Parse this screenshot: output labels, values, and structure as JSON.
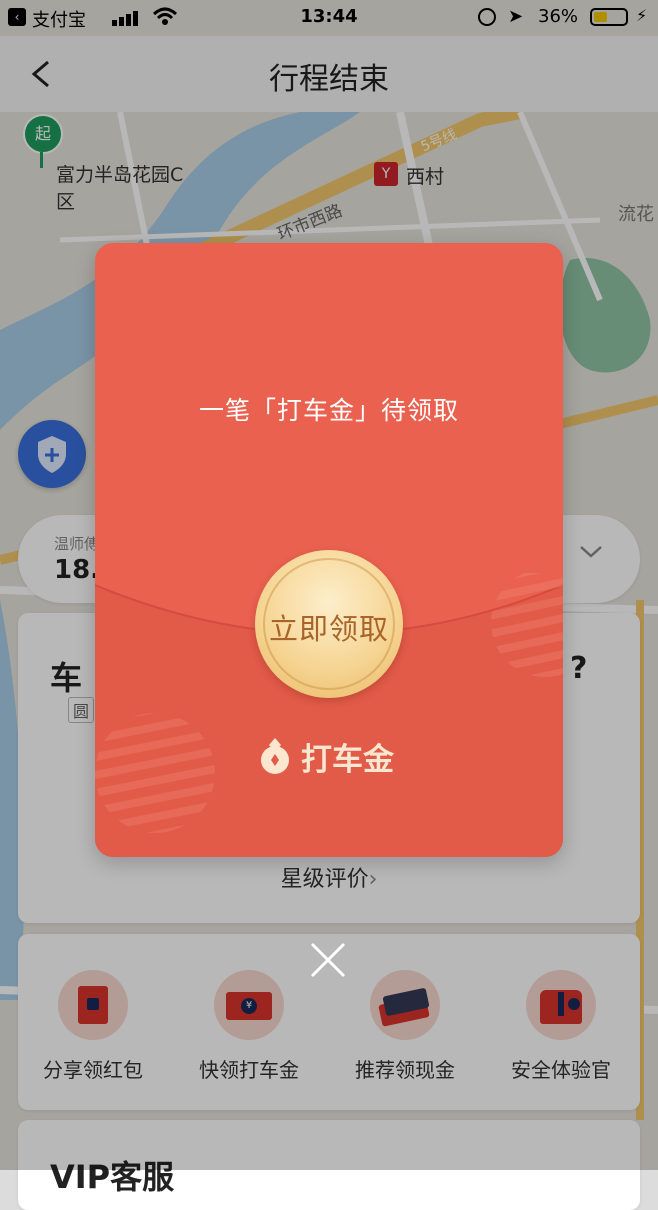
{
  "statusbar": {
    "back_app": "支付宝",
    "time": "13:44",
    "battery_pct": "36%"
  },
  "nav": {
    "title": "行程结束"
  },
  "map": {
    "start_badge": "起",
    "start_place_line1": "富力半岛花园C",
    "start_place_line2": "区",
    "metro_icon": "Y",
    "metro_station": "西村",
    "road1": "环市西路",
    "road2": "5号线",
    "corner_label": "流花"
  },
  "fare": {
    "label": "温师傅",
    "value": "18.7"
  },
  "driver": {
    "name_prefix": "车",
    "badge": "圆",
    "rating_link": "星级评价",
    "help": "?"
  },
  "services": [
    {
      "label": "分享领红包",
      "icon": "red-envelope-icon"
    },
    {
      "label": "快领打车金",
      "icon": "cash-voucher-icon"
    },
    {
      "label": "推荐领现金",
      "icon": "cash-stack-icon"
    },
    {
      "label": "安全体验官",
      "icon": "safety-officer-icon"
    }
  ],
  "vip": {
    "title": "VIP客服"
  },
  "packet": {
    "title": "一笔「打车金」待领取",
    "claim_button": "立即领取",
    "brand_name": "打车金"
  },
  "colors": {
    "packet_red": "#ea6150",
    "coin_gold": "#f6d594",
    "coin_text": "#a9642a"
  }
}
